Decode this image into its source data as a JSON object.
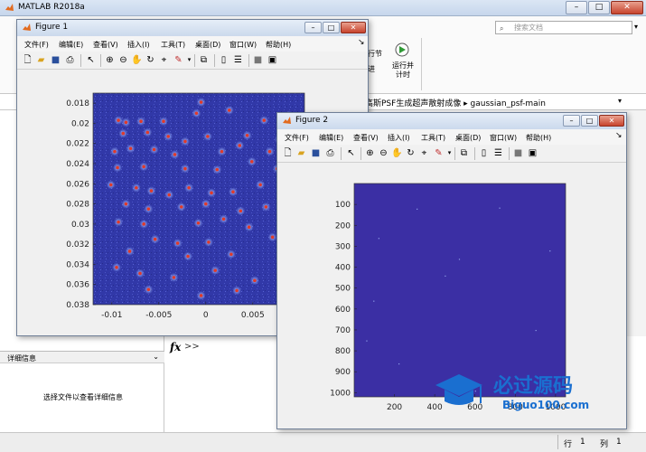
{
  "app": {
    "title": "MATLAB R2018a",
    "search_placeholder": "搜索文档",
    "ribbon_labels": {
      "run_section": "行节",
      "advance": "进",
      "run_and_time": "运行并\n计时"
    },
    "current_path": "高斯PSF生成超声散射成像  ▸  gaussian_psf-main",
    "details_label": "详细信息",
    "details_message": "选择文件以查看详细信息",
    "fx": "fx",
    "prompt": ">>",
    "status": {
      "line_label": "行",
      "line_value": "1",
      "col_label": "列",
      "col_value": "1"
    }
  },
  "menus": [
    "文件(F)",
    "编辑(E)",
    "查看(V)",
    "插入(I)",
    "工具(T)",
    "桌面(D)",
    "窗口(W)",
    "帮助(H)"
  ],
  "figure1": {
    "title": "Figure 1",
    "chart_data": {
      "type": "scatter",
      "title": "",
      "xlabel": "",
      "ylabel": "",
      "xlim": [
        -0.012,
        0.0105
      ],
      "ylim": [
        0.017,
        0.038
      ],
      "yreversed": true,
      "xticks": [
        "-0.01",
        "-0.005",
        "0",
        "0.005"
      ],
      "yticks": [
        "0.018",
        "0.02",
        "0.022",
        "0.024",
        "0.026",
        "0.028",
        "0.03",
        "0.032",
        "0.034",
        "0.036",
        "0.038"
      ],
      "background_color": "#3138a8",
      "marker_color": "#e03a2a",
      "points": [
        [
          -0.0093,
          0.0197
        ],
        [
          -0.0085,
          0.0199
        ],
        [
          -0.0069,
          0.0198
        ],
        [
          -0.0045,
          0.0198
        ],
        [
          -0.001,
          0.019
        ],
        [
          -0.0005,
          0.0179
        ],
        [
          0.0025,
          0.0187
        ],
        [
          0.0062,
          0.0197
        ],
        [
          0.0088,
          0.0192
        ],
        [
          0.0094,
          0.0204
        ],
        [
          -0.0088,
          0.021
        ],
        [
          -0.0062,
          0.0209
        ],
        [
          -0.004,
          0.0213
        ],
        [
          -0.0022,
          0.0218
        ],
        [
          0.0002,
          0.0213
        ],
        [
          0.0044,
          0.0212
        ],
        [
          0.0078,
          0.0216
        ],
        [
          0.0098,
          0.0221
        ],
        [
          -0.0097,
          0.0228
        ],
        [
          -0.008,
          0.0225
        ],
        [
          -0.0055,
          0.0226
        ],
        [
          -0.0033,
          0.0231
        ],
        [
          0.0017,
          0.0228
        ],
        [
          0.0036,
          0.0222
        ],
        [
          0.0068,
          0.0228
        ],
        [
          0.009,
          0.0235
        ],
        [
          -0.0094,
          0.0244
        ],
        [
          -0.0066,
          0.0243
        ],
        [
          -0.0022,
          0.0245
        ],
        [
          0.0012,
          0.0246
        ],
        [
          0.0049,
          0.0238
        ],
        [
          0.0076,
          0.0245
        ],
        [
          -0.0101,
          0.0261
        ],
        [
          -0.0074,
          0.0264
        ],
        [
          -0.0058,
          0.0267
        ],
        [
          -0.0039,
          0.0271
        ],
        [
          -0.0018,
          0.0264
        ],
        [
          0.0006,
          0.0269
        ],
        [
          0.0029,
          0.0268
        ],
        [
          0.0058,
          0.0261
        ],
        [
          0.0081,
          0.0264
        ],
        [
          -0.0085,
          0.028
        ],
        [
          -0.0061,
          0.0285
        ],
        [
          -0.0026,
          0.0283
        ],
        [
          0.0,
          0.028
        ],
        [
          0.0037,
          0.0287
        ],
        [
          0.0064,
          0.0283
        ],
        [
          -0.0093,
          0.0298
        ],
        [
          -0.0066,
          0.03
        ],
        [
          -0.0008,
          0.0299
        ],
        [
          0.0019,
          0.0295
        ],
        [
          0.0046,
          0.0303
        ],
        [
          -0.0054,
          0.0315
        ],
        [
          -0.003,
          0.0319
        ],
        [
          0.0003,
          0.0318
        ],
        [
          0.0071,
          0.0313
        ],
        [
          -0.0081,
          0.0327
        ],
        [
          -0.0019,
          0.0332
        ],
        [
          0.0027,
          0.033
        ],
        [
          -0.0095,
          0.0343
        ],
        [
          -0.007,
          0.0349
        ],
        [
          -0.0034,
          0.0353
        ],
        [
          0.001,
          0.0346
        ],
        [
          0.0052,
          0.0356
        ],
        [
          -0.0061,
          0.0365
        ],
        [
          -0.0005,
          0.0371
        ],
        [
          0.0033,
          0.0366
        ],
        [
          0.0082,
          0.0373
        ]
      ]
    }
  },
  "figure2": {
    "title": "Figure 2",
    "chart_data": {
      "type": "heatmap",
      "title": "",
      "xlabel": "",
      "ylabel": "",
      "xlim": [
        0,
        1050
      ],
      "ylim": [
        0,
        1020
      ],
      "yreversed": true,
      "xticks": [
        "200",
        "400",
        "600",
        "800",
        "1000"
      ],
      "yticks": [
        "100",
        "200",
        "300",
        "400",
        "500",
        "600",
        "700",
        "800",
        "900",
        "1000"
      ],
      "background_color": "#3b2fa4",
      "sparse_points": [
        [
          310,
          120
        ],
        [
          720,
          115
        ],
        [
          120,
          260
        ],
        [
          520,
          360
        ],
        [
          450,
          440
        ],
        [
          970,
          320
        ],
        [
          95,
          560
        ],
        [
          60,
          750
        ],
        [
          220,
          860
        ],
        [
          600,
          990
        ],
        [
          800,
          925
        ],
        [
          900,
          700
        ]
      ]
    }
  },
  "watermark": {
    "main": "必过源码",
    "sub": "Biguo100.com"
  }
}
